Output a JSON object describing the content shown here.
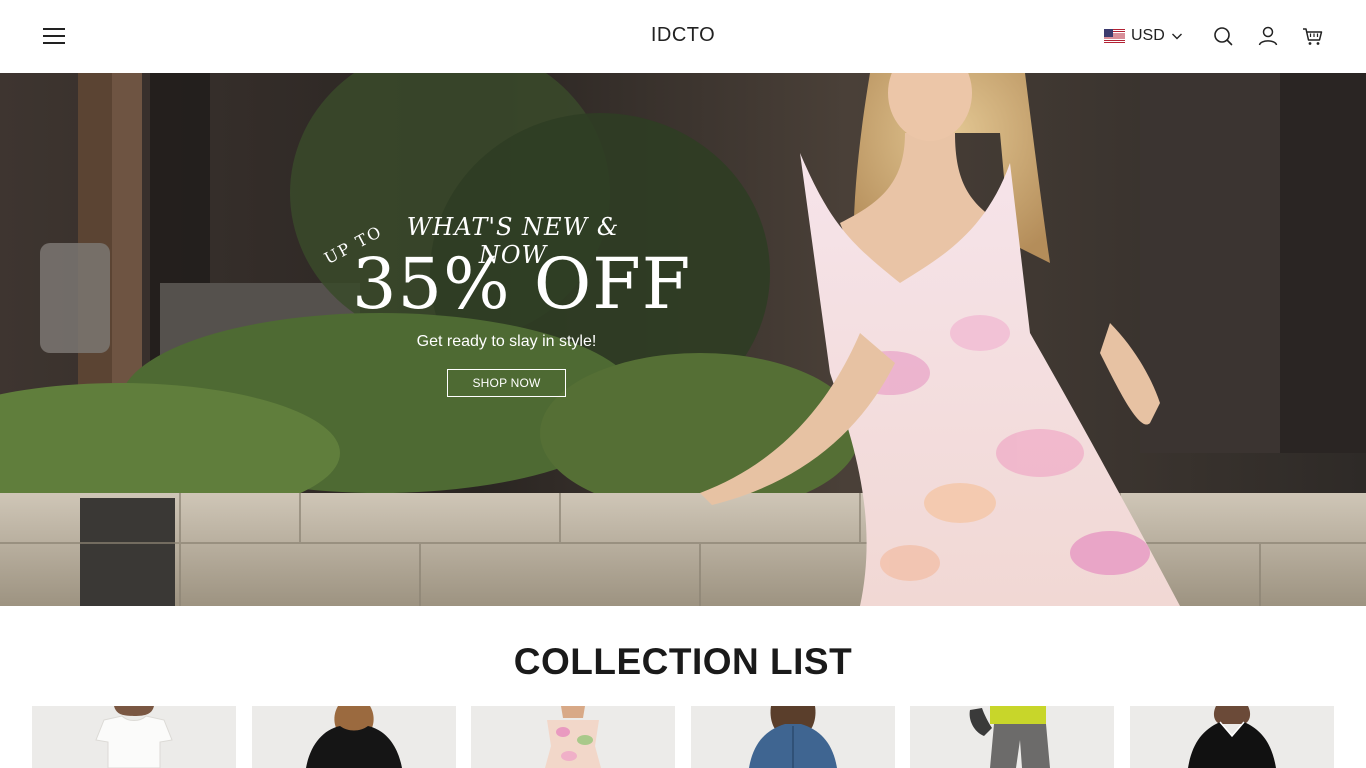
{
  "header": {
    "logo": "IDCTO",
    "currency": "USD",
    "icons": [
      "menu-icon",
      "flag-us-icon",
      "chevron-down-icon",
      "search-icon",
      "account-icon",
      "cart-icon"
    ]
  },
  "hero": {
    "eyebrow": "WHAT'S NEW & NOW",
    "up_to": "UP TO",
    "offer": "35% OFF",
    "subtitle": "Get ready to slay in style!",
    "cta": "SHOP NOW"
  },
  "collection": {
    "title": "COLLECTION LIST",
    "cards": [
      {
        "name": "white t-shirt"
      },
      {
        "name": "black top"
      },
      {
        "name": "floral strapless dress"
      },
      {
        "name": "denim shirt"
      },
      {
        "name": "grey trousers"
      },
      {
        "name": "black pajama set"
      }
    ]
  },
  "colors": {
    "header_bg": "#ffffff",
    "text": "#1a1a1a",
    "hero_text": "#ffffff"
  }
}
